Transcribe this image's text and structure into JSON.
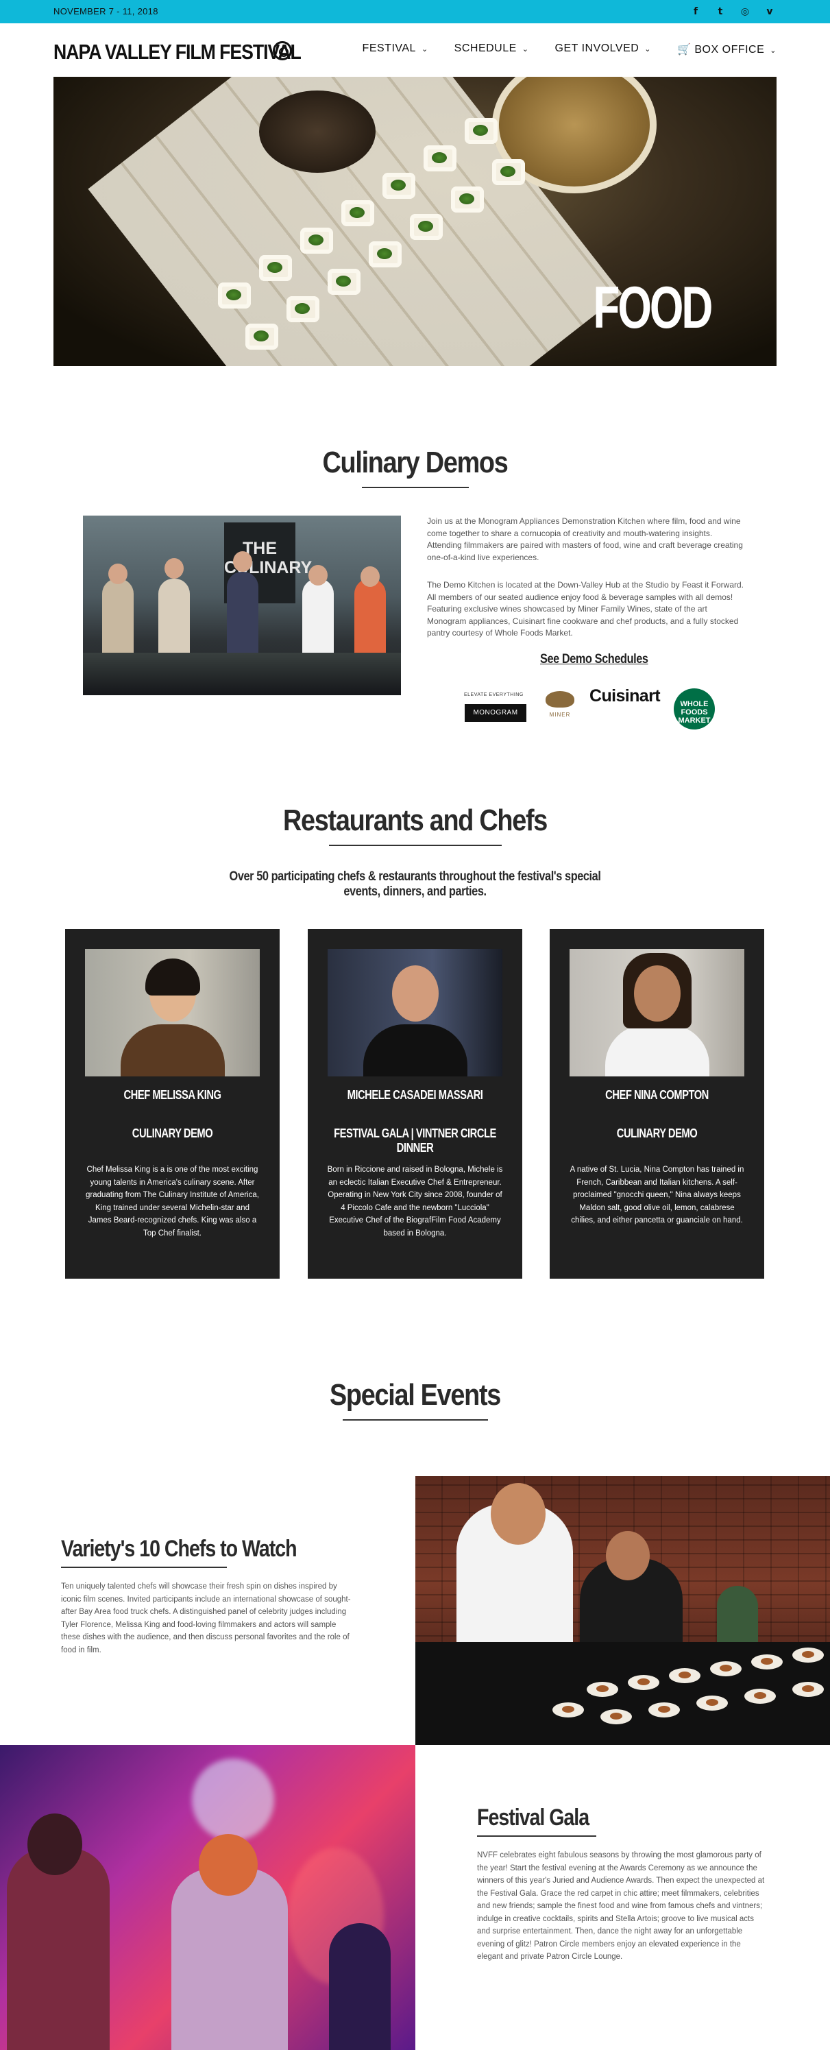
{
  "topbar": {
    "date": "NOVEMBER 7 - 11, 2018",
    "social": [
      {
        "icon": "facebook-icon",
        "glyph": "f"
      },
      {
        "icon": "twitter-icon",
        "glyph": "t"
      },
      {
        "icon": "instagram-icon",
        "glyph": "◎"
      },
      {
        "icon": "vimeo-icon",
        "glyph": "v"
      }
    ]
  },
  "nav": {
    "logo": "NAPA VALLEY FILM FESTIVAL",
    "menu": [
      {
        "label": "FESTIVAL",
        "chev": "⌄"
      },
      {
        "label": "SCHEDULE",
        "chev": "⌄"
      },
      {
        "label": "GET INVOLVED",
        "chev": "⌄"
      },
      {
        "label": "🛒 BOX OFFICE",
        "chev": "⌄"
      }
    ]
  },
  "hero": {
    "title": "FOOD"
  },
  "culinary": {
    "heading": "Culinary Demos",
    "sign": "THE CULINARY",
    "para1": "Join us at the Monogram Appliances Demonstration Kitchen where film, food and wine come together to share a cornucopia of creativity and mouth-watering insights. Attending filmmakers are paired with masters of food, wine and craft beverage creating one-of-a-kind live experiences.",
    "para2": "The Demo Kitchen is located at the Down-Valley Hub at the Studio by Feast it Forward. All members of our seated audience enjoy food & beverage samples with all demos! Featuring exclusive wines showcased by Miner Family Wines, state of the art Monogram appliances, Cuisinart fine cookware and chef products, and a fully stocked pantry courtesy of Whole Foods Market.",
    "link": "See Demo Schedules",
    "sponsors": {
      "monogram_tagline": "ELEVATE EVERYTHING",
      "monogram": "MONOGRAM",
      "miner": "MINER",
      "cuisinart": "Cuisinart",
      "wholefoods": "WHOLE FOODS MARKET"
    }
  },
  "restaurants": {
    "heading": "Restaurants and Chefs",
    "subtitle": "Over 50 participating chefs & restaurants throughout the festival's special events, dinners, and parties."
  },
  "chefs": [
    {
      "name": "CHEF MELISSA KING",
      "role": "CULINARY DEMO",
      "bio": "Chef Melissa King is a is one of the most exciting young talents in America's culinary scene. After graduating from The Culinary Institute of America, King trained under several Michelin-star and James Beard-recognized chefs. King was also a Top Chef finalist."
    },
    {
      "name": "MICHELE CASADEI MASSARI",
      "role": "FESTIVAL GALA | VINTNER CIRCLE DINNER",
      "bio": "Born in Riccione and raised in Bologna, Michele is an eclectic Italian Executive Chef & Entrepreneur. Operating in New York City since 2008, founder of 4 Piccolo Cafe and the newborn \"Lucciola\" Executive Chef of the BiografFilm Food Academy based in Bologna."
    },
    {
      "name": "CHEF NINA COMPTON",
      "role": "CULINARY DEMO",
      "bio": "A native of St. Lucia, Nina Compton has trained in French, Caribbean and Italian kitchens. A self-proclaimed \"gnocchi queen,\" Nina always keeps Maldon salt, good olive oil, lemon, calabrese chilies, and either pancetta or guanciale on hand."
    }
  ],
  "events": {
    "heading": "Special Events",
    "items": [
      {
        "title": "Variety's 10 Chefs to Watch",
        "text": "Ten uniquely talented chefs will showcase their fresh spin on dishes inspired by iconic film scenes. Invited participants include an international showcase of sought-after Bay Area food truck chefs. A distinguished panel of celebrity judges including Tyler Florence, Melissa King and food-loving filmmakers and actors will sample these dishes with the audience, and then discuss personal favorites and the role of food in film."
      },
      {
        "title": "Festival Gala",
        "text": "NVFF celebrates eight fabulous seasons by throwing the most glamorous party of the year! Start the festival evening at the Awards Ceremony as we announce the winners of this year's Juried and Audience Awards. Then expect the unexpected at the Festival Gala. Grace the red carpet in chic attire; meet filmmakers, celebrities and new friends; sample the finest food and wine from famous chefs and vintners; indulge in creative cocktails, spirits and Stella Artois; groove to live musical acts and surprise entertainment. Then, dance the night away for an unforgettable evening of glitz! Patron Circle members enjoy an elevated experience in the elegant and private Patron Circle Lounge."
      }
    ]
  },
  "colors": {
    "topbar": "#0fb8d9",
    "card": "#202020",
    "wholefoods": "#006f46"
  }
}
